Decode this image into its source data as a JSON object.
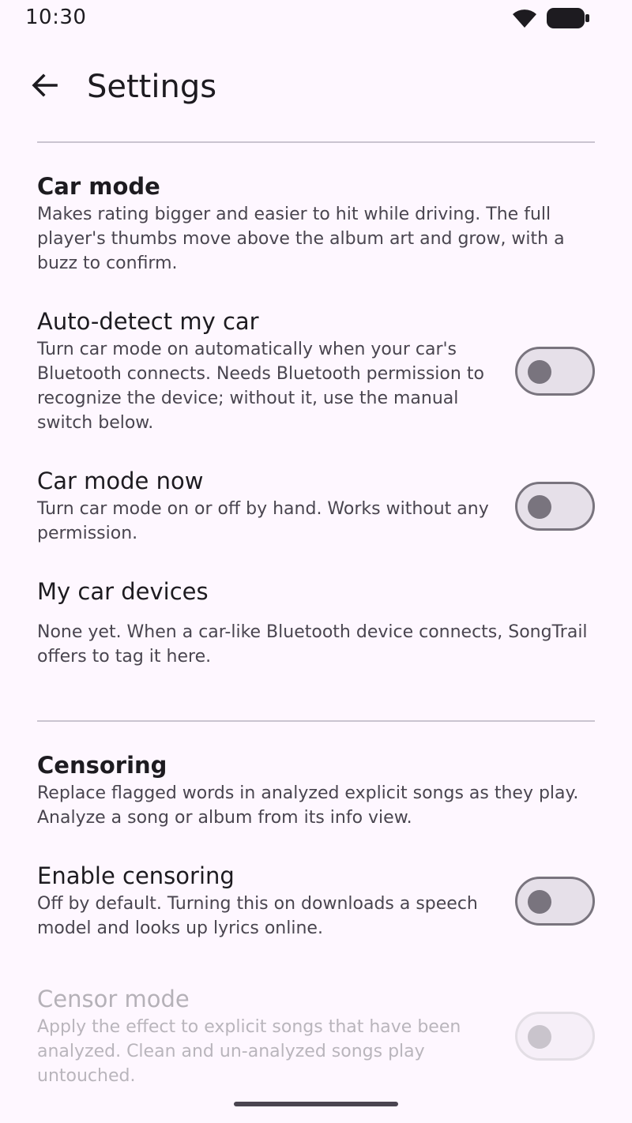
{
  "status_bar": {
    "time": "10:30",
    "wifi_icon": "wifi-icon",
    "battery_icon": "battery-icon"
  },
  "top_bar": {
    "back_icon": "arrow-back-icon",
    "title": "Settings"
  },
  "car_mode_section": {
    "title": "Car mode",
    "description": "Makes rating bigger and easier to hit while driving. The full player's thumbs move above the album art and grow, with a buzz to confirm.",
    "auto_detect": {
      "title": "Auto-detect my car",
      "description": "Turn car mode on automatically when your car's Bluetooth connects. Needs Bluetooth permission to recognize the device; without it, use the manual switch below.",
      "enabled": false
    },
    "car_mode_now": {
      "title": "Car mode now",
      "description": "Turn car mode on or off by hand. Works without any permission.",
      "enabled": false
    },
    "my_car_devices": {
      "title": "My car devices",
      "description": "None yet. When a car-like Bluetooth device connects, SongTrail offers to tag it here."
    }
  },
  "censoring_section": {
    "title": "Censoring",
    "description": "Replace flagged words in analyzed explicit songs as they play. Analyze a song or album from its info view.",
    "enable_censoring": {
      "title": "Enable censoring",
      "description": "Off by default. Turning this on downloads a speech model and looks up lyrics online.",
      "enabled": false
    },
    "censor_mode": {
      "title": "Censor mode",
      "description": "Apply the effect to explicit songs that have been analyzed. Clean and un-analyzed songs play untouched.",
      "enabled": false,
      "disabled": true
    }
  },
  "colors": {
    "background": "#FEF7FF",
    "divider": "#CAC4D0",
    "switch_track": "#E6E0E9",
    "switch_outline": "#79747E"
  }
}
